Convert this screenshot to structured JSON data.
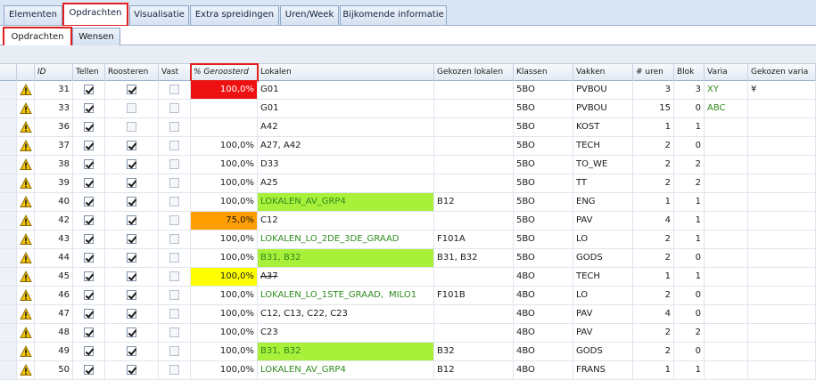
{
  "tabs_main": [
    "Elementen",
    "Opdrachten",
    "Visualisatie",
    "Extra spreidingen",
    "Uren/Week",
    "Bijkomende informatie"
  ],
  "tabs_sub": [
    "Opdrachten",
    "Wensen"
  ],
  "columns": [
    "ID",
    "Tellen",
    "Roosteren",
    "Vast",
    "% Geroosterd",
    "Lokalen",
    "Gekozen lokalen",
    "Klassen",
    "Vakken",
    "# uren",
    "Blok",
    "Varia",
    "Gekozen varia"
  ],
  "colors": {
    "red": "#ee1111",
    "orange": "#ff9e00",
    "yellow": "#ffff00",
    "lime": "#a8f03a",
    "green_text": "#2f8a1e"
  },
  "icons": {
    "warning": "warning-icon",
    "checkbox": "checkbox-icon"
  },
  "rows": [
    {
      "id": "31",
      "tellen": true,
      "roosteren": true,
      "vast": false,
      "pct": "100,0%",
      "pct_color": "red",
      "lokalen": "G01",
      "lok_style": "",
      "gekozen": "",
      "klassen": "5BO",
      "vakken": "PVBOU",
      "uren": "3",
      "blok": "3",
      "varia": "XY",
      "gekozen_varia": "¥"
    },
    {
      "id": "33",
      "tellen": true,
      "roosteren": false,
      "vast": false,
      "pct": "",
      "pct_color": "",
      "lokalen": "G01",
      "lok_style": "",
      "gekozen": "",
      "klassen": "5BO",
      "vakken": "PVBOU",
      "uren": "15",
      "blok": "0",
      "varia": "ABC",
      "gekozen_varia": ""
    },
    {
      "id": "36",
      "tellen": true,
      "roosteren": false,
      "vast": false,
      "pct": "",
      "pct_color": "",
      "lokalen": "A42",
      "lok_style": "",
      "gekozen": "",
      "klassen": "5BO",
      "vakken": "KOST",
      "uren": "1",
      "blok": "1",
      "varia": "",
      "gekozen_varia": ""
    },
    {
      "id": "37",
      "tellen": true,
      "roosteren": true,
      "vast": false,
      "pct": "100,0%",
      "pct_color": "",
      "lokalen": "A27, A42",
      "lok_style": "",
      "gekozen": "",
      "klassen": "5BO",
      "vakken": "TECH",
      "uren": "2",
      "blok": "0",
      "varia": "",
      "gekozen_varia": ""
    },
    {
      "id": "38",
      "tellen": true,
      "roosteren": true,
      "vast": false,
      "pct": "100,0%",
      "pct_color": "",
      "lokalen": "D33",
      "lok_style": "",
      "gekozen": "",
      "klassen": "5BO",
      "vakken": "TO_WE",
      "uren": "2",
      "blok": "2",
      "varia": "",
      "gekozen_varia": ""
    },
    {
      "id": "39",
      "tellen": true,
      "roosteren": true,
      "vast": false,
      "pct": "100,0%",
      "pct_color": "",
      "lokalen": "A25",
      "lok_style": "",
      "gekozen": "",
      "klassen": "5BO",
      "vakken": "TT",
      "uren": "2",
      "blok": "2",
      "varia": "",
      "gekozen_varia": ""
    },
    {
      "id": "40",
      "tellen": true,
      "roosteren": true,
      "vast": false,
      "pct": "100,0%",
      "pct_color": "",
      "lokalen": "LOKALEN_AV_GRP4",
      "lok_style": "lime",
      "gekozen": "B12",
      "klassen": "5BO",
      "vakken": "ENG",
      "uren": "1",
      "blok": "1",
      "varia": "",
      "gekozen_varia": ""
    },
    {
      "id": "42",
      "tellen": true,
      "roosteren": true,
      "vast": false,
      "pct": "75,0%",
      "pct_color": "orange",
      "lokalen": "C12",
      "lok_style": "",
      "gekozen": "",
      "klassen": "5BO",
      "vakken": "PAV",
      "uren": "4",
      "blok": "1",
      "varia": "",
      "gekozen_varia": ""
    },
    {
      "id": "43",
      "tellen": true,
      "roosteren": true,
      "vast": false,
      "pct": "100,0%",
      "pct_color": "",
      "lokalen": "LOKALEN_LO_2DE_3DE_GRAAD",
      "lok_style": "green",
      "gekozen": "F101A",
      "klassen": "5BO",
      "vakken": "LO",
      "uren": "2",
      "blok": "1",
      "varia": "",
      "gekozen_varia": ""
    },
    {
      "id": "44",
      "tellen": true,
      "roosteren": true,
      "vast": false,
      "pct": "100,0%",
      "pct_color": "",
      "lokalen": "B31, B32",
      "lok_style": "lime",
      "gekozen": "B31, B32",
      "klassen": "5BO",
      "vakken": "GODS",
      "uren": "2",
      "blok": "0",
      "varia": "",
      "gekozen_varia": ""
    },
    {
      "id": "45",
      "tellen": true,
      "roosteren": true,
      "vast": false,
      "pct": "100,0%",
      "pct_color": "yellow",
      "lokalen": "A37",
      "lok_style": "strike",
      "gekozen": "",
      "klassen": "4BO",
      "vakken": "TECH",
      "uren": "1",
      "blok": "1",
      "varia": "",
      "gekozen_varia": ""
    },
    {
      "id": "46",
      "tellen": true,
      "roosteren": true,
      "vast": false,
      "pct": "100,0%",
      "pct_color": "",
      "lokalen": "LOKALEN_LO_1STE_GRAAD,",
      "lok_extra": "MILO1",
      "lok_style": "green",
      "gekozen": "F101B",
      "klassen": "4BO",
      "vakken": "LO",
      "uren": "2",
      "blok": "0",
      "varia": "",
      "gekozen_varia": ""
    },
    {
      "id": "47",
      "tellen": true,
      "roosteren": true,
      "vast": false,
      "pct": "100,0%",
      "pct_color": "",
      "lokalen": "C12, C13, C22, C23",
      "lok_style": "",
      "gekozen": "",
      "klassen": "4BO",
      "vakken": "PAV",
      "uren": "4",
      "blok": "0",
      "varia": "",
      "gekozen_varia": ""
    },
    {
      "id": "48",
      "tellen": true,
      "roosteren": true,
      "vast": false,
      "pct": "100,0%",
      "pct_color": "",
      "lokalen": "C23",
      "lok_style": "",
      "gekozen": "",
      "klassen": "4BO",
      "vakken": "PAV",
      "uren": "2",
      "blok": "2",
      "varia": "",
      "gekozen_varia": ""
    },
    {
      "id": "49",
      "tellen": true,
      "roosteren": true,
      "vast": false,
      "pct": "100,0%",
      "pct_color": "",
      "lokalen": "B31, B32",
      "lok_style": "lime",
      "gekozen": "B32",
      "klassen": "4BO",
      "vakken": "GODS",
      "uren": "2",
      "blok": "0",
      "varia": "",
      "gekozen_varia": ""
    },
    {
      "id": "50",
      "tellen": true,
      "roosteren": true,
      "vast": false,
      "pct": "100,0%",
      "pct_color": "",
      "lokalen": "LOKALEN_AV_GRP4",
      "lok_style": "green",
      "gekozen": "B12",
      "klassen": "4BO",
      "vakken": "FRANS",
      "uren": "1",
      "blok": "1",
      "varia": "",
      "gekozen_varia": ""
    }
  ]
}
